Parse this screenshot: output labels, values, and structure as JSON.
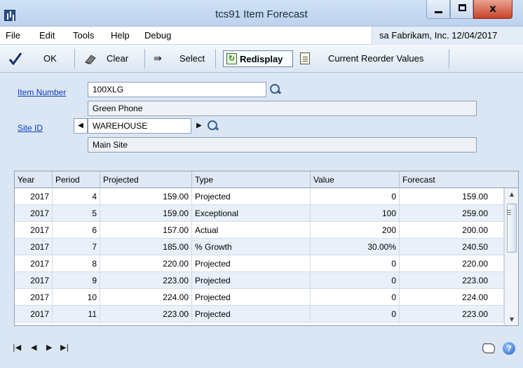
{
  "window": {
    "title": "tcs91 Item Forecast",
    "close_glyph": "x"
  },
  "menu": {
    "items": [
      "File",
      "Edit",
      "Tools",
      "Help",
      "Debug"
    ],
    "context": "sa  Fabrikam, Inc. 12/04/2017"
  },
  "toolbar": {
    "ok_label": "OK",
    "clear_label": "Clear",
    "select_label": "Select",
    "redisplay_label": "Redisplay",
    "reorder_label": "Current Reorder Values"
  },
  "form": {
    "item_number_label": "Item Number",
    "item_number_value": "100XLG",
    "item_description": "Green Phone",
    "site_id_label": "Site ID",
    "site_id_value": "WAREHOUSE",
    "site_description": "Main Site"
  },
  "grid": {
    "headers": [
      "Year",
      "Period",
      "Projected",
      "Type",
      "Value",
      "Forecast"
    ],
    "rows": [
      [
        "2017",
        "4",
        "159.00",
        "Projected",
        "0",
        "159.00"
      ],
      [
        "2017",
        "5",
        "159.00",
        "Exceptional",
        "100",
        "259.00"
      ],
      [
        "2017",
        "6",
        "157.00",
        "Actual",
        "200",
        "200.00"
      ],
      [
        "2017",
        "7",
        "185.00",
        "% Growth",
        "30.00%",
        "240.50"
      ],
      [
        "2017",
        "8",
        "220.00",
        "Projected",
        "0",
        "220.00"
      ],
      [
        "2017",
        "9",
        "223.00",
        "Projected",
        "0",
        "223.00"
      ],
      [
        "2017",
        "10",
        "224.00",
        "Projected",
        "0",
        "224.00"
      ],
      [
        "2017",
        "11",
        "223.00",
        "Projected",
        "0",
        "223.00"
      ]
    ]
  },
  "icons": {
    "check": "check-icon",
    "clear": "eraser-icon",
    "select": "select-arrow-icon",
    "redisplay": "refresh-icon",
    "reorder": "clipboard-icon",
    "lookup": "magnifier-icon",
    "note": "note-icon",
    "help": "help-icon"
  },
  "colors": {
    "link": "#0b3dbf",
    "alt_row": "#e9f0fa",
    "window_bg": "#dbe6f4"
  }
}
